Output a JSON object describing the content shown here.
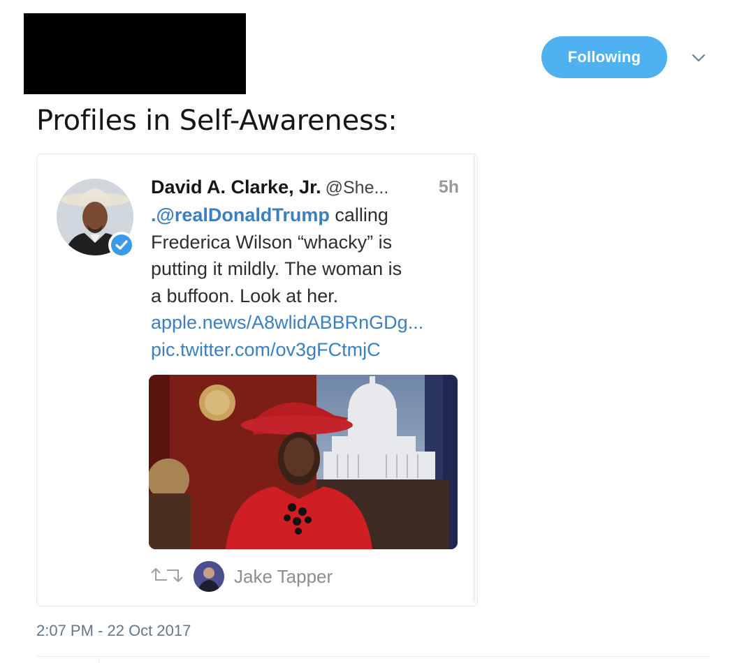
{
  "header": {
    "follow_button_label": "Following",
    "caret_icon": "chevron-down-icon"
  },
  "tweet": {
    "text": "Profiles in Self-Awareness:",
    "timestamp": "2:07 PM - 22 Oct 2017"
  },
  "quoted_screenshot": {
    "name": "David A. Clarke, Jr.",
    "handle": "@She...",
    "time": "5h",
    "mention": ".@realDonaldTrump",
    "line1_rest": " calling",
    "line2": "Frederica Wilson “whacky” is",
    "line3": "putting it mildly. The woman is",
    "line4": "a buffoon. Look at her.",
    "link1": "apple.news/A8wlidABBRnGDg...",
    "link2": "pic.twitter.com/ov3gFCtmjC",
    "retweeted_by": "Jake Tapper",
    "verified_icon": "verified-badge-icon",
    "retweet_icon": "retweet-icon"
  },
  "colors": {
    "follow_bg": "#4fb1ef",
    "link": "#3b7fbf",
    "verified": "#3a9be6"
  }
}
